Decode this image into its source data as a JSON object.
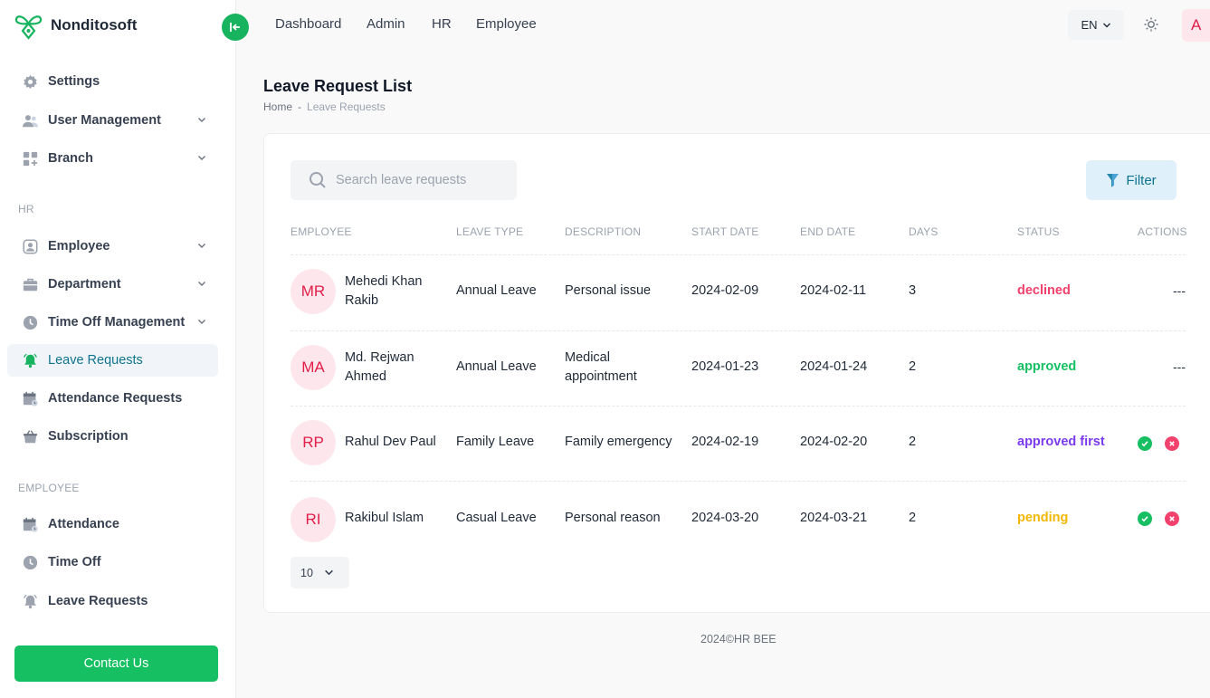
{
  "brand": {
    "name": "Nonditosoft",
    "icon": "bee-logo-icon"
  },
  "colors": {
    "accent": "#16c062",
    "link": "#0e7490",
    "declined": "#f1416c",
    "approved": "#16c062",
    "approved_first": "#7c3aed",
    "pending": "#f2b705"
  },
  "sidebar": {
    "items": [
      {
        "label": "Settings",
        "icon": "gear-icon"
      },
      {
        "label": "User Management",
        "icon": "users-icon"
      },
      {
        "label": "Branch",
        "icon": "grid-icon"
      },
      {
        "label": "Employee",
        "icon": "user-box-icon"
      },
      {
        "label": "Department",
        "icon": "briefcase-icon"
      },
      {
        "label": "Time Off Management",
        "icon": "clock-icon"
      },
      {
        "label": "Leave Requests",
        "icon": "bell-icon"
      },
      {
        "label": "Attendance Requests",
        "icon": "calendar-icon"
      },
      {
        "label": "Subscription",
        "icon": "basket-icon"
      },
      {
        "label": "Attendance",
        "icon": "calendar-icon"
      },
      {
        "label": "Time Off",
        "icon": "clock-icon"
      },
      {
        "label": "Leave Requests",
        "icon": "bell-icon"
      }
    ],
    "section_hr": "HR",
    "section_employee": "EMPLOYEE",
    "contact_label": "Contact Us"
  },
  "topbar": {
    "nav": [
      "Dashboard",
      "Admin",
      "HR",
      "Employee"
    ],
    "language": "EN",
    "avatar_letter": "A"
  },
  "page": {
    "title": "Leave Request List",
    "breadcrumb_home": "Home",
    "breadcrumb_sep": "-",
    "breadcrumb_current": "Leave Requests"
  },
  "toolbar": {
    "search_placeholder": "Search leave requests",
    "filter_label": "Filter"
  },
  "table": {
    "headers": [
      "EMPLOYEE",
      "LEAVE TYPE",
      "DESCRIPTION",
      "START DATE",
      "END DATE",
      "DAYS",
      "STATUS",
      "ACTIONS"
    ],
    "rows": [
      {
        "initials": "MR",
        "name": "Mehedi Khan Rakib",
        "leave_type": "Annual Leave",
        "description": "Personal issue",
        "start": "2024-02-09",
        "end": "2024-02-11",
        "days": "3",
        "status": "declined",
        "actions": "---"
      },
      {
        "initials": "MA",
        "name": "Md. Rejwan Ahmed",
        "leave_type": "Annual Leave",
        "description": "Medical appointment",
        "start": "2024-01-23",
        "end": "2024-01-24",
        "days": "2",
        "status": "approved",
        "actions": "---"
      },
      {
        "initials": "RP",
        "name": "Rahul Dev Paul",
        "leave_type": "Family Leave",
        "description": "Family emergency",
        "start": "2024-02-19",
        "end": "2024-02-20",
        "days": "2",
        "status": "approved first",
        "actions": ""
      },
      {
        "initials": "RI",
        "name": "Rakibul Islam",
        "leave_type": "Casual Leave",
        "description": "Personal reason",
        "start": "2024-03-20",
        "end": "2024-03-21",
        "days": "2",
        "status": "pending",
        "actions": ""
      }
    ]
  },
  "pagination": {
    "page_size": "10"
  },
  "footer": {
    "text": "2024©HR BEE"
  }
}
